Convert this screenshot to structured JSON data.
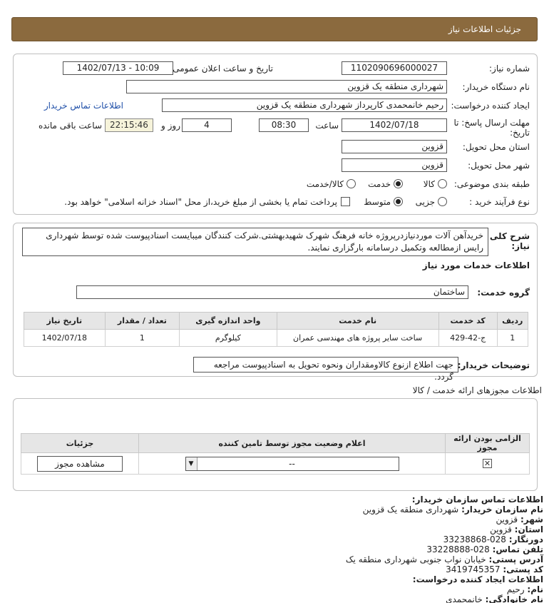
{
  "header": {
    "title": "جزئیات اطلاعات نیاز"
  },
  "info": {
    "need_number_label": "شماره نیاز:",
    "need_number": "1102090696000027",
    "announce_label": "تاریخ و ساعت اعلان عمومی:",
    "announce_value": "1402/07/13 - 10:09",
    "buyer_label": "نام دستگاه خریدار:",
    "buyer_value": "شهرداری منطقه یک قزوین",
    "creator_label": "ایجاد کننده درخواست:",
    "creator_value": "رحیم خانمحمدی کارپرداز شهرداری منطقه یک قزوین",
    "contact_link": "اطلاعات تماس خریدار",
    "deadline_label_1": "مهلت ارسال پاسخ: تا",
    "deadline_label_2": "تاریخ:",
    "deadline_date": "1402/07/18",
    "time_label": "ساعت",
    "deadline_time": "08:30",
    "days": "4",
    "days_label": "روز و",
    "remaining": "22:15:46",
    "remaining_label": "ساعت باقی مانده",
    "province_label": "استان محل تحویل:",
    "province_value": "قزوین",
    "city_label": "شهر محل تحویل:",
    "city_value": "قزوین",
    "category_label": "طبقه بندی موضوعی:",
    "category_options": [
      "کالا",
      "خدمت",
      "کالا/خدمت"
    ],
    "process_label": "نوع فرآیند خرید :",
    "process_options": [
      "جزیی",
      "متوسط"
    ],
    "payment_note": "پرداخت تمام یا بخشی از مبلغ خرید،از محل \"اسناد خزانه اسلامی\" خواهد بود."
  },
  "description": {
    "label_1": "شرح کلی",
    "label_2": "نیاز:",
    "text": "خریدآهن آلات موردنیازدرپروژه خانه فرهنگ شهرک شهیدبهشتی.شرکت کنندگان میبایست اسنادپیوست شده توسط شهرداری رایس ازمطالعه وتکمیل درسامانه بارگزاری نمایند."
  },
  "services": {
    "title": "اطلاعات خدمات مورد نیاز",
    "group_label": "گروه خدمت:",
    "group_value": "ساختمان",
    "columns": [
      "ردیف",
      "کد خدمت",
      "نام خدمت",
      "واحد اندازه گیری",
      "تعداد / مقدار",
      "تاریخ نیاز"
    ],
    "rows": [
      {
        "row": "1",
        "code": "ج-42-429",
        "name": "ساخت سایر پروژه های مهندسی عمران",
        "unit": "کیلوگرم",
        "qty": "1",
        "date": "1402/07/18"
      }
    ],
    "buyer_notes_label": "توضیحات خریدار:",
    "buyer_notes": "جهت اطلاع ازنوع کالاومقداران ونحوه تحویل به اسنادپیوست مراجعه گردد."
  },
  "permits": {
    "title": "اطلاعات مجوزهای ارائه خدمت / کالا",
    "columns": [
      "الزامی بودن ارائه مجوز",
      "اعلام وضعیت مجوز توسط تامین کننده",
      "جزئیات"
    ],
    "status_value": "--",
    "view_button": "مشاهده مجوز"
  },
  "contact": {
    "title": "اطلاعات تماس سازمان خریدار:",
    "org_label": "نام سازمان خریدار:",
    "org_value": "شهرداری منطقه یک قزوین",
    "city_label": "شهر:",
    "city_value": "قزوین",
    "province_label": "استان:",
    "province_value": "قزوین",
    "fax_label": "دورنگار:",
    "fax_value": "028-33238868",
    "phone_label": "تلفن تماس:",
    "phone_value": "028-33228888",
    "address_label": "آدرس پستی:",
    "address_value": "خیابان نواب جنوبی شهرداری منطقه یک",
    "postal_label": "کد پستی:",
    "postal_value": "3419745357",
    "requester_title": "اطلاعات ایجاد کننده درخواست:",
    "name_label": "نام:",
    "name_value": "رحیم",
    "family_label": "نام خانوادگی:",
    "family_value": "خانمحمدی"
  }
}
